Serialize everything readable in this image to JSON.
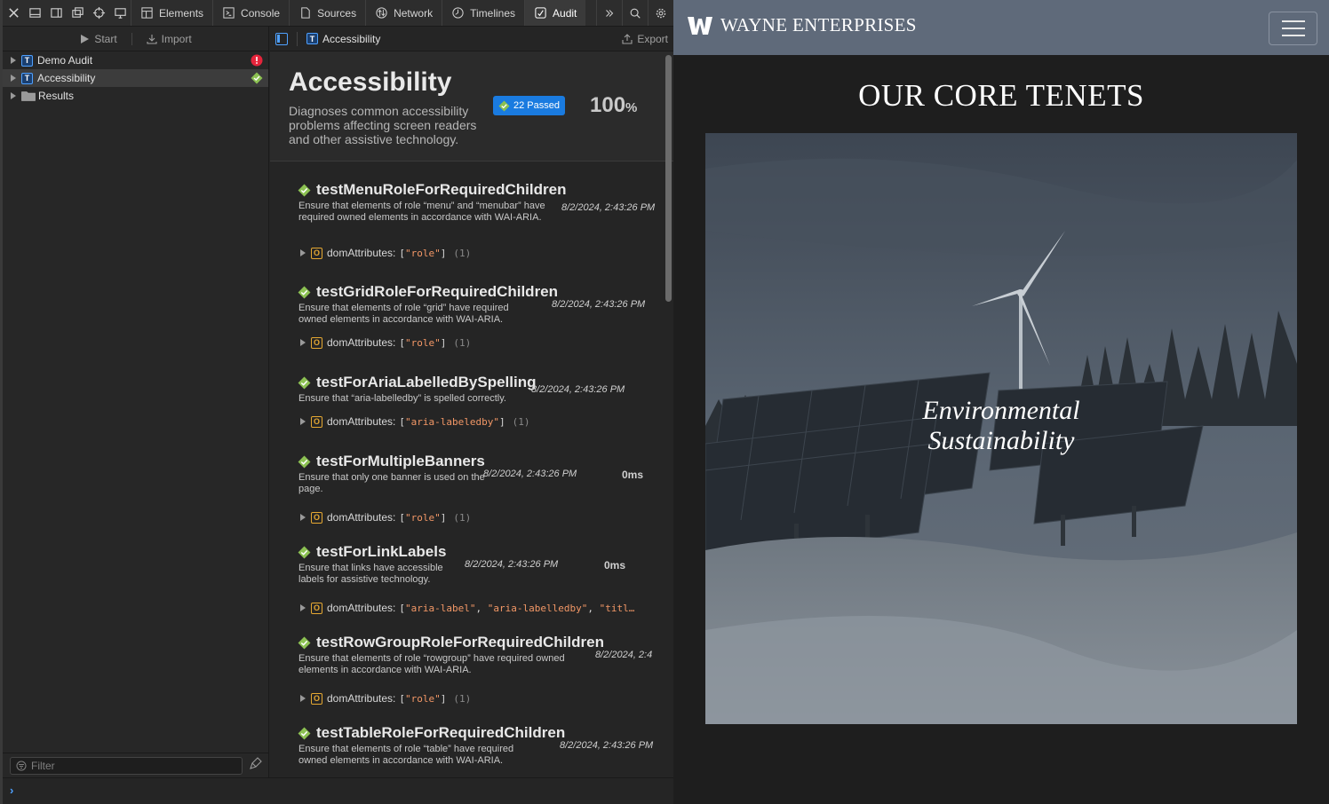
{
  "devtools": {
    "tabs": [
      {
        "label": "Elements",
        "icon": "elements-icon"
      },
      {
        "label": "Console",
        "icon": "console-icon"
      },
      {
        "label": "Sources",
        "icon": "sources-icon"
      },
      {
        "label": "Network",
        "icon": "network-icon"
      },
      {
        "label": "Timelines",
        "icon": "timelines-icon"
      },
      {
        "label": "Audit",
        "icon": "audit-icon",
        "active": true
      }
    ],
    "sidebar": {
      "start_label": "Start",
      "import_label": "Import",
      "items": [
        {
          "label": "Demo Audit",
          "badge": "T",
          "status": "error"
        },
        {
          "label": "Accessibility",
          "badge": "T",
          "status": "passed",
          "selected": true
        },
        {
          "label": "Results",
          "badge": "folder"
        }
      ],
      "filter_placeholder": "Filter"
    },
    "content": {
      "breadcrumb_badge": "T",
      "breadcrumb": "Accessibility",
      "export_label": "Export",
      "header": {
        "title": "Accessibility",
        "description": "Diagnoses common accessibility problems affecting screen readers and other assistive technology.",
        "passed_label": "22 Passed",
        "percent_value": "100",
        "percent_unit": "%"
      },
      "tests": [
        {
          "name": "testMenuRoleForRequiredChildren",
          "description": "Ensure that elements of role “menu” and “menubar” have required owned elements in accordance with WAI-ARIA.",
          "timestamp": "8/2/2024, 2:43:26 PM",
          "duration": "",
          "attr_label": "domAttributes:",
          "attr_open": "[",
          "attr_values": [
            "\"role\""
          ],
          "attr_close": "]",
          "attr_count": "(1)"
        },
        {
          "name": "testGridRoleForRequiredChildren",
          "description": "Ensure that elements of role “grid” have required owned elements in accordance with WAI-ARIA.",
          "timestamp": "8/2/2024, 2:43:26 PM",
          "duration": "",
          "attr_label": "domAttributes:",
          "attr_open": "[",
          "attr_values": [
            "\"role\""
          ],
          "attr_close": "]",
          "attr_count": "(1)"
        },
        {
          "name": "testForAriaLabelledBySpelling",
          "description": "Ensure that “aria-labelledby” is spelled correctly.",
          "timestamp": "8/2/2024, 2:43:26 PM",
          "duration": "",
          "attr_label": "domAttributes:",
          "attr_open": "[",
          "attr_values": [
            "\"aria-labeledby\""
          ],
          "attr_close": "]",
          "attr_count": "(1)"
        },
        {
          "name": "testForMultipleBanners",
          "description": "Ensure that only one banner is used on the page.",
          "timestamp": "8/2/2024, 2:43:26 PM",
          "duration": "0ms",
          "attr_label": "domAttributes:",
          "attr_open": "[",
          "attr_values": [
            "\"role\""
          ],
          "attr_close": "]",
          "attr_count": "(1)"
        },
        {
          "name": "testForLinkLabels",
          "description": "Ensure that links have accessible labels for assistive technology.",
          "timestamp": "8/2/2024, 2:43:26 PM",
          "duration": "0ms",
          "attr_label": "domAttributes:",
          "attr_open": "[",
          "attr_values": [
            "\"aria-label\"",
            "\"aria-labelledby\"",
            "\"titl…"
          ],
          "attr_close": "",
          "attr_count": ""
        },
        {
          "name": "testRowGroupRoleForRequiredChildren",
          "description": "Ensure that elements of role “rowgroup” have required owned elements in accordance with WAI-ARIA.",
          "timestamp": "8/2/2024, 2:4",
          "duration": "",
          "attr_label": "domAttributes:",
          "attr_open": "[",
          "attr_values": [
            "\"role\""
          ],
          "attr_close": "]",
          "attr_count": "(1)"
        },
        {
          "name": "testTableRoleForRequiredChildren",
          "description": "Ensure that elements of role “table” have required owned elements in accordance with WAI-ARIA.",
          "timestamp": "8/2/2024, 2:43:26 PM",
          "duration": "",
          "attr_label": "",
          "attr_open": "",
          "attr_values": [],
          "attr_close": "",
          "attr_count": ""
        }
      ]
    },
    "console_prompt": "›",
    "colors": {
      "accent": "#1a7be0",
      "string": "#f29766",
      "object_badge": "#e5a832",
      "error": "#e5243b",
      "pass": "#8cc152"
    }
  },
  "site": {
    "brand": "WAYNE ENTERPRISES",
    "heading": "OUR CORE TENETS",
    "hero_caption_line1": "Environmental",
    "hero_caption_line2": "Sustainability",
    "nav_color": "#5f6a7a"
  }
}
